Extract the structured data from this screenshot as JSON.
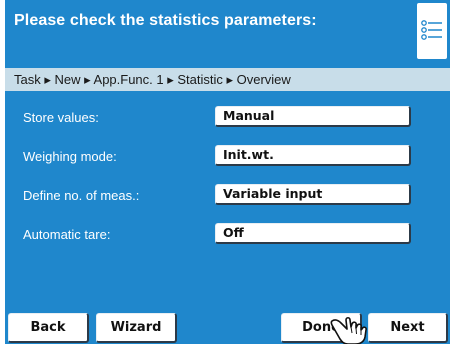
{
  "header": {
    "title": "Please check the statistics parameters:",
    "menu_icon": "list-icon"
  },
  "breadcrumb": {
    "text": "Task ▸ New ▸ App.Func. 1 ▸ Statistic ▸ Overview"
  },
  "settings": [
    {
      "label": "Store values:",
      "value": "Manual"
    },
    {
      "label": "Weighing mode:",
      "value": "Init.wt."
    },
    {
      "label": "Define no. of meas.:",
      "value": "Variable input"
    },
    {
      "label": "Automatic tare:",
      "value": "Off"
    }
  ],
  "footer": {
    "back_label": "Back",
    "wizard_label": "Wizard",
    "done_label": "Done",
    "next_label": "Next"
  },
  "cursor_icon": "hand-pointer-icon",
  "colors": {
    "background_blue": "#1f87cc",
    "breadcrumb_bg": "#c8dde9",
    "button_bg": "#ffffff",
    "button_shadow": "#2c3a48"
  }
}
